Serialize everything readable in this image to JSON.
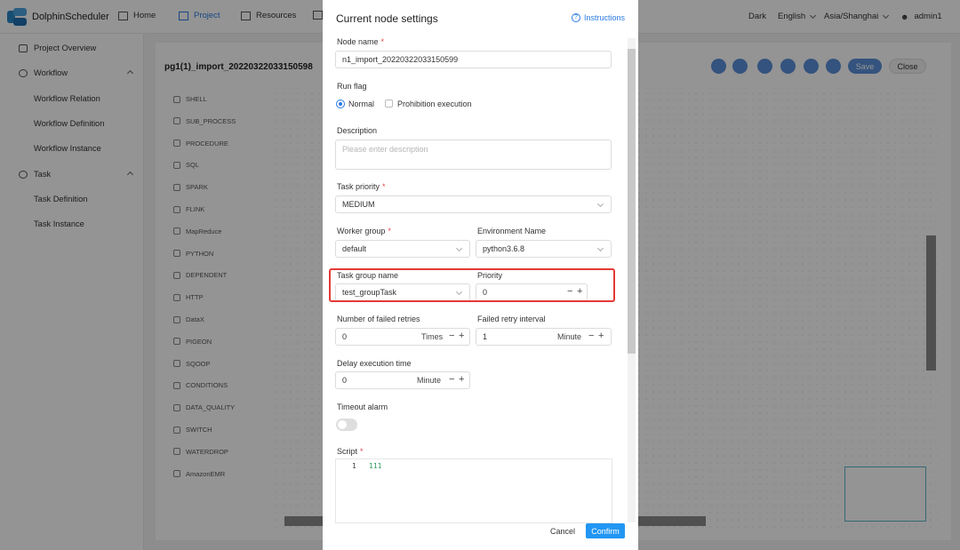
{
  "app": {
    "name": "DolphinScheduler"
  },
  "topnav": [
    {
      "label": "Home",
      "icon": "home-icon"
    },
    {
      "label": "Project",
      "icon": "project-icon",
      "active": true
    },
    {
      "label": "Resources",
      "icon": "folder-icon"
    }
  ],
  "topright": {
    "theme": "Dark",
    "language": "English",
    "timezone": "Asia/Shanghai",
    "user": "admin1"
  },
  "sidebar": {
    "items": [
      {
        "label": "Project Overview",
        "icon": "overview-icon"
      },
      {
        "label": "Workflow",
        "icon": "workflow-icon"
      },
      {
        "label": "Workflow Relation"
      },
      {
        "label": "Workflow Definition"
      },
      {
        "label": "Workflow Instance"
      },
      {
        "label": "Task",
        "icon": "gear-icon"
      },
      {
        "label": "Task Definition"
      },
      {
        "label": "Task Instance"
      }
    ]
  },
  "workflow": {
    "title": "pg1(1)_import_20220322033150598",
    "save_label": "Save",
    "close_label": "Close"
  },
  "palette": [
    "SHELL",
    "SUB_PROCESS",
    "PROCEDURE",
    "SQL",
    "SPARK",
    "FLINK",
    "MapReduce",
    "PYTHON",
    "DEPENDENT",
    "HTTP",
    "DataX",
    "PIGEON",
    "SQOOP",
    "CONDITIONS",
    "DATA_QUALITY",
    "SWITCH",
    "WATERDROP",
    "AmazonEMR"
  ],
  "modal": {
    "title": "Current node settings",
    "instructions": "Instructions",
    "node_name": {
      "label": "Node name",
      "value": "n1_import_20220322033150599"
    },
    "run_flag": {
      "label": "Run flag",
      "normal": "Normal",
      "prohibition": "Prohibition execution"
    },
    "description": {
      "label": "Description",
      "placeholder": "Please enter description"
    },
    "task_priority": {
      "label": "Task priority",
      "value": "MEDIUM"
    },
    "worker_group": {
      "label": "Worker group",
      "value": "default"
    },
    "environment": {
      "label": "Environment Name",
      "value": "python3.6.8"
    },
    "task_group": {
      "label": "Task group name",
      "value": "test_groupTask"
    },
    "priority": {
      "label": "Priority",
      "value": "0"
    },
    "failed_retries": {
      "label": "Number of failed retries",
      "value": "0",
      "unit": "Times"
    },
    "retry_interval": {
      "label": "Failed retry interval",
      "value": "1",
      "unit": "Minute"
    },
    "delay": {
      "label": "Delay execution time",
      "value": "0",
      "unit": "Minute"
    },
    "timeout": {
      "label": "Timeout alarm",
      "enabled": false
    },
    "script": {
      "label": "Script",
      "line_no": "1",
      "code": "111"
    },
    "cancel_label": "Cancel",
    "confirm_label": "Confirm"
  },
  "colors": {
    "accent": "#2a7be4",
    "confirm": "#2196f3",
    "highlight": "#e53935",
    "required": "#e5484d"
  }
}
